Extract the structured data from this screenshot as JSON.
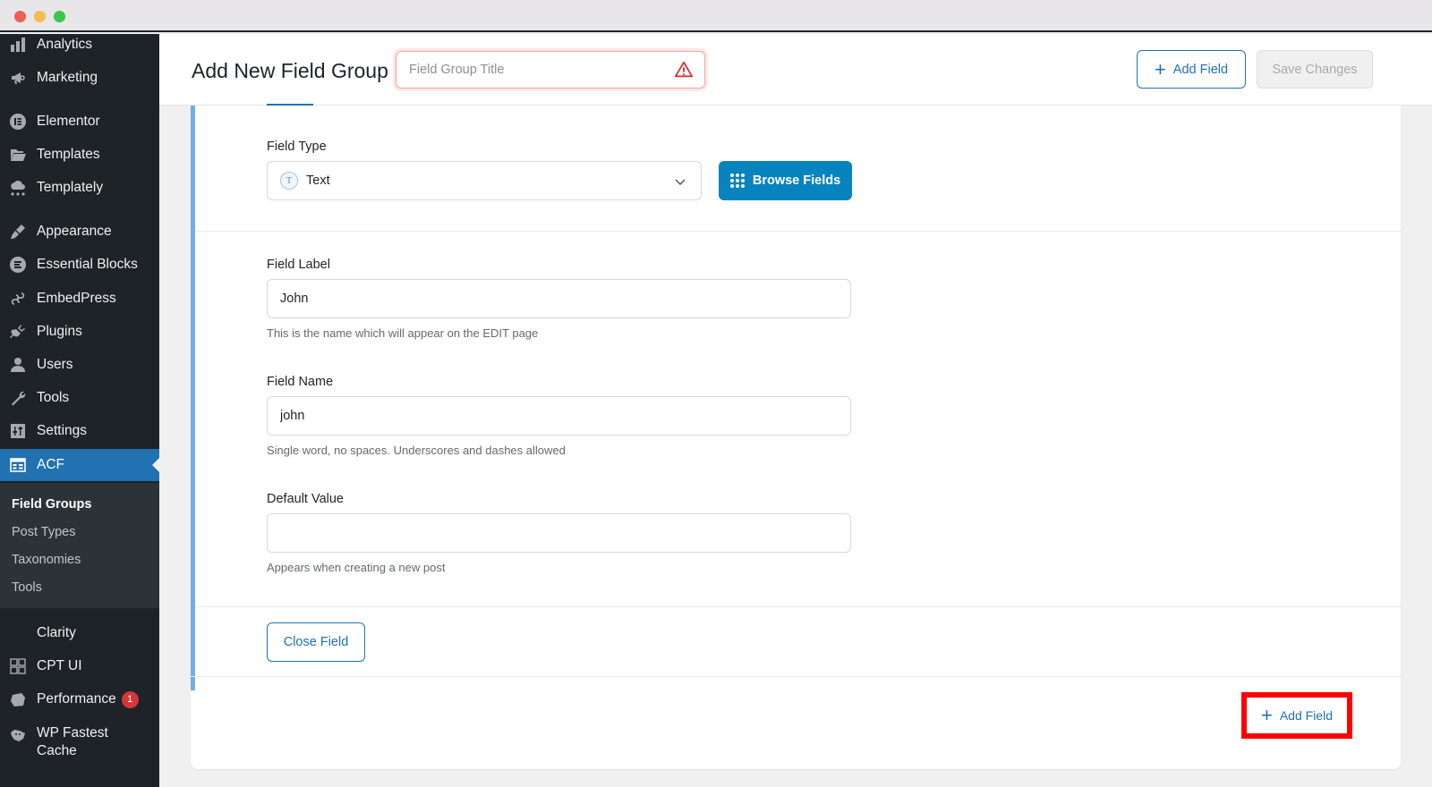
{
  "window": {
    "traffic_lights": [
      "close",
      "minimize",
      "maximize"
    ]
  },
  "sidebar": {
    "items": [
      {
        "label": "Analytics",
        "icon": "bar-chart-icon"
      },
      {
        "label": "Marketing",
        "icon": "megaphone-icon"
      },
      {
        "label": "Elementor",
        "icon": "elementor-icon"
      },
      {
        "label": "Templates",
        "icon": "folder-icon"
      },
      {
        "label": "Templately",
        "icon": "cloud-icon"
      },
      {
        "label": "Appearance",
        "icon": "paintbrush-icon"
      },
      {
        "label": "Essential Blocks",
        "icon": "essential-blocks-icon"
      },
      {
        "label": "EmbedPress",
        "icon": "embedpress-icon"
      },
      {
        "label": "Plugins",
        "icon": "plug-icon"
      },
      {
        "label": "Users",
        "icon": "user-icon"
      },
      {
        "label": "Tools",
        "icon": "wrench-icon"
      },
      {
        "label": "Settings",
        "icon": "sliders-icon"
      },
      {
        "label": "ACF",
        "icon": "acf-icon",
        "active": true
      },
      {
        "label": "Clarity",
        "icon": ""
      },
      {
        "label": "CPT UI",
        "icon": "cpt-grid-icon"
      },
      {
        "label": "Performance",
        "icon": "performance-icon",
        "badge": "1"
      },
      {
        "label": "WP Fastest Cache",
        "icon": "cheetah-icon"
      }
    ],
    "submenu": [
      {
        "label": "Field Groups",
        "current": true
      },
      {
        "label": "Post Types"
      },
      {
        "label": "Taxonomies"
      },
      {
        "label": "Tools"
      }
    ]
  },
  "header": {
    "title": "Add New Field Group",
    "title_input_placeholder": "Field Group Title",
    "title_input_value": "",
    "add_field_label": "Add Field",
    "save_label": "Save Changes"
  },
  "field": {
    "type_label": "Field Type",
    "type_value": "Text",
    "type_icon_glyph": "T",
    "browse_label": "Browse Fields",
    "label_label": "Field Label",
    "label_value": "John",
    "label_help": "This is the name which will appear on the EDIT page",
    "name_label": "Field Name",
    "name_value": "john",
    "name_help": "Single word, no spaces. Underscores and dashes allowed",
    "default_label": "Default Value",
    "default_value": "",
    "default_help": "Appears when creating a new post",
    "close_label": "Close Field"
  },
  "footer": {
    "add_field_label": "Add Field"
  },
  "colors": {
    "accent": "#2271b1",
    "sidebar_bg": "#1d2327",
    "active_menu_bg": "#2271b1",
    "browse_button": "#0783be",
    "error": "#d63638",
    "highlight": "#ff0000"
  }
}
